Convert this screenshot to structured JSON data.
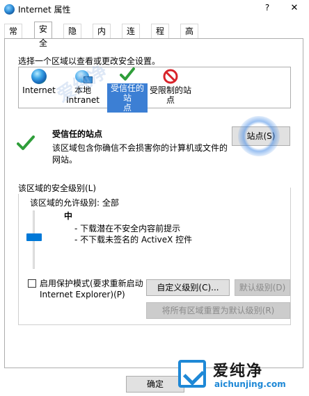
{
  "window": {
    "title": "Internet 属性",
    "help": "?",
    "close": "✕"
  },
  "tabs": [
    "常规",
    "安全",
    "隐私",
    "内容",
    "连接",
    "程序",
    "高级"
  ],
  "active_tab": "安全",
  "zone_caption": "选择一个区域以查看或更改安全设置。",
  "zones": [
    {
      "icon": "globe-icon",
      "label": "Internet"
    },
    {
      "icon": "local-intranet-icon",
      "label": "本地\nIntranet"
    },
    {
      "icon": "checkmark-icon",
      "label": "受信任的站\n点"
    },
    {
      "icon": "no-entry-icon",
      "label": "受限制的站\n点"
    }
  ],
  "selected_zone": "受信任的站点",
  "trusted": {
    "title": "受信任的站点",
    "description": "该区域包含你确信不会损害你的计算机或文件的网站。"
  },
  "sites_button": "站点(S)",
  "security_level": {
    "legend": "该区域的安全级别(L)",
    "allowed": "该区域的允许级别: 全部",
    "level": "中",
    "items": [
      "- 下载潜在不安全内容前提示",
      "- 不下载未签名的 ActiveX 控件"
    ],
    "slider_fraction": 0.45
  },
  "protected_mode": {
    "label": "启用保护模式(要求重新启动 Internet Explorer)(P)",
    "checked": false
  },
  "custom_level_button": "自定义级别(C)...",
  "default_level_button": "默认级别(D)",
  "reset_all_button": "将所有区域重置为默认级别(R)",
  "ok_button": "确定",
  "watermark": {
    "cn": "爱纯净",
    "url": "aichunjing.com",
    "faint": "爱纯净"
  },
  "colors": {
    "accent": "#0078d7",
    "selection": "#3c7fd4",
    "check_green": "#2f9e3a",
    "stop_red": "#d8232a"
  }
}
